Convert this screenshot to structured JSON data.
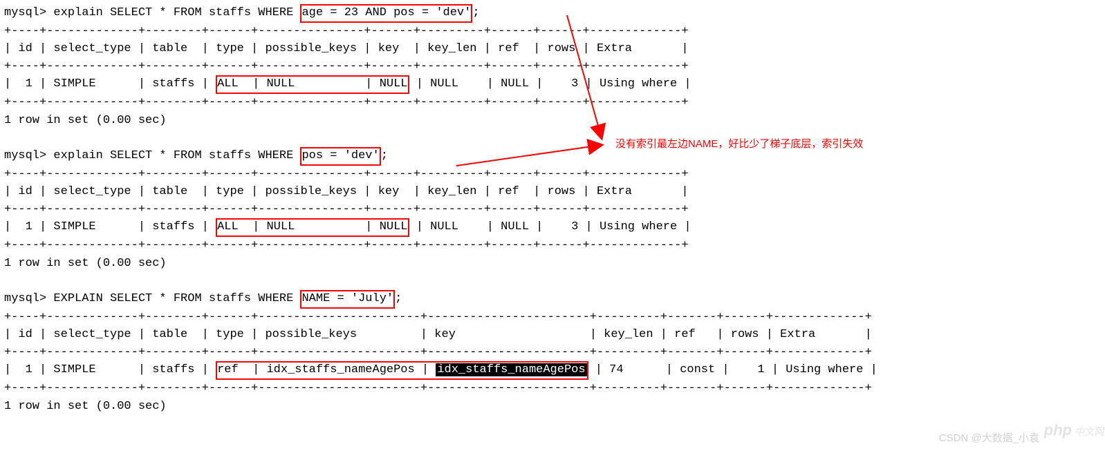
{
  "q1": {
    "prompt": "mysql> explain SELECT * FROM staffs WHERE ",
    "cond": "age = 23 AND pos = 'dev'",
    "tail": ";",
    "border": "+----+-------------+--------+------+---------------+------+---------+------+------+-------------+",
    "header": "| id | select_type | table  | type | possible_keys | key  | key_len | ref  | rows | Extra       |",
    "row_pre": "|  1 | SIMPLE      | staffs | ",
    "row_box": "ALL  | NULL          | NULL",
    "row_post": " | NULL    | NULL |    3 | Using where |",
    "footer": "1 row in set (0.00 sec)"
  },
  "q2": {
    "prompt": "mysql> explain SELECT * FROM staffs WHERE ",
    "cond": "pos = 'dev'",
    "tail": ";",
    "border": "+----+-------------+--------+------+---------------+------+---------+------+------+-------------+",
    "header": "| id | select_type | table  | type | possible_keys | key  | key_len | ref  | rows | Extra       |",
    "row_pre": "|  1 | SIMPLE      | staffs | ",
    "row_box": "ALL  | NULL          | NULL",
    "row_post": " | NULL    | NULL |    3 | Using where |",
    "footer": "1 row in set (0.00 sec)"
  },
  "q3": {
    "prompt": "mysql> EXPLAIN SELECT * FROM staffs WHERE ",
    "cond": "NAME = 'July'",
    "tail": ";",
    "border": "+----+-------------+--------+------+-----------------------+-----------------------+---------+-------+------+-------------+",
    "header": "| id | select_type | table  | type | possible_keys         | key                   | key_len | ref   | rows | Extra       |",
    "row_pre": "|  1 | SIMPLE      | staffs | ",
    "row_box_a": "ref  | idx_staffs_nameAgePos | ",
    "row_box_inv": "idx_staffs_nameAgePos",
    "row_post": " | 74      | const |    1 | Using where |",
    "footer": "1 row in set (0.00 sec)"
  },
  "annotation": "没有索引最左边NAME，好比少了梯子底层，索引失效",
  "watermark_csdn": "CSDN @大数据_小袁",
  "watermark_php": "中文网"
}
